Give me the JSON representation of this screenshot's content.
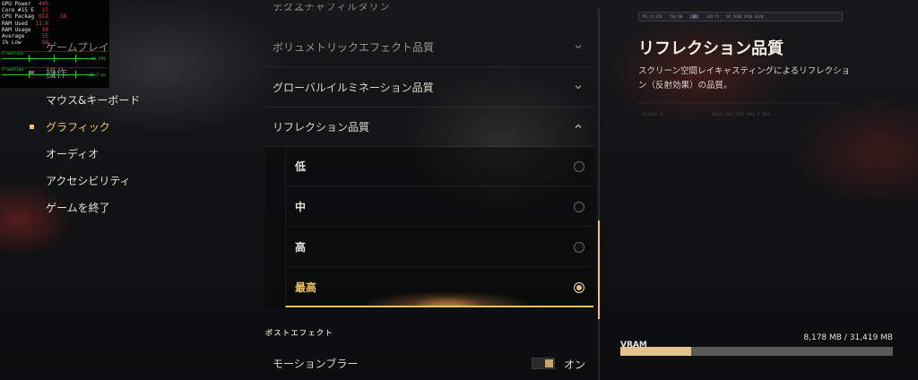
{
  "overlay": {
    "rows": [
      {
        "name": "GPU Power",
        "v1": "445",
        "v2": ""
      },
      {
        "name": "Core #15 E",
        "v1": "17",
        "v2": ""
      },
      {
        "name": "CPU Package",
        "v1": "652",
        "v2": "38"
      },
      {
        "name": "RAM Used",
        "v1": "11.0",
        "v2": ""
      },
      {
        "name": "RAM Usage",
        "v1": "10",
        "v2": ""
      },
      {
        "name": "Average",
        "v1": "55",
        "v2": ""
      },
      {
        "name": "1% Low",
        "v1": "88",
        "v2": ""
      }
    ],
    "graph1": {
      "label": "Framerate",
      "value": "60 FPS"
    },
    "graph2": {
      "label": "Frametime",
      "value": "16.7 ms"
    }
  },
  "nav": {
    "items": [
      {
        "label": "ゲームプレイ",
        "state": "dim"
      },
      {
        "label": "操作",
        "state": "dim"
      },
      {
        "label": "マウス&キーボード",
        "state": "normal"
      },
      {
        "label": "グラフィック",
        "state": "active"
      },
      {
        "label": "オーディオ",
        "state": "normal"
      },
      {
        "label": "アクセシビリティ",
        "state": "normal"
      },
      {
        "label": "ゲームを終了",
        "state": "normal"
      }
    ]
  },
  "settings": {
    "clipped_top": "テクスチャフィルタリング品質",
    "rows": [
      {
        "label": "ボリュメトリックエフェクト品質",
        "expanded": false
      },
      {
        "label": "グローバルイルミネーション品質",
        "expanded": false
      },
      {
        "label": "リフレクション品質",
        "expanded": true
      }
    ],
    "options": [
      {
        "label": "低",
        "selected": false
      },
      {
        "label": "中",
        "selected": false
      },
      {
        "label": "高",
        "selected": false
      },
      {
        "label": "最高",
        "selected": true
      }
    ],
    "section": "ポストエフェクト",
    "motion_blur": {
      "label": "モーションブラー",
      "value": "オン"
    },
    "scroll_position": 0.6
  },
  "info": {
    "title": "リフレクション品質",
    "description": "スクリーン空間レイキャスティングによるリフレクション（反射効果）の品質。",
    "preview_bar": [
      "PS_st_678",
      "TAA_00",
      "3D",
      "181 ft",
      "4K 7680 1920 4320"
    ],
    "faint_left": "RELEASE 78",
    "faint_right": "BUILD 3487 9787 7863 9 3887"
  },
  "vram": {
    "label": "VRAM",
    "used_mb": 8178,
    "total_mb": 31419,
    "text": "8,178 MB / 31,419 MB"
  },
  "colors": {
    "accent": "#f0c36a",
    "vram_fill": "#e3c48c",
    "overlay_value": "#ff3b3b",
    "overlay_graph": "#2ecc40"
  }
}
